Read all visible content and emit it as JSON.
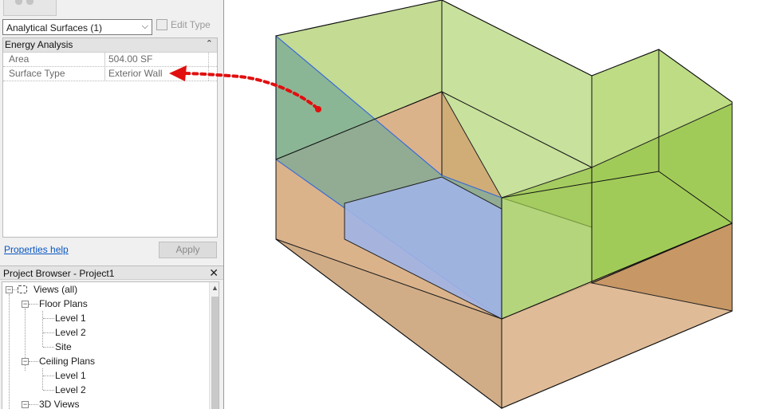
{
  "properties": {
    "type_selector": "Analytical Surfaces (1)",
    "edit_type_label": "Edit Type",
    "group": "Energy Analysis",
    "rows": [
      {
        "name": "Area",
        "value": "504.00 SF"
      },
      {
        "name": "Surface Type",
        "value": "Exterior Wall"
      }
    ],
    "help_link": "Properties help",
    "apply_label": "Apply"
  },
  "project_browser": {
    "title": "Project Browser - Project1",
    "tree": {
      "views_all": "Views (all)",
      "floor_plans": "Floor Plans",
      "floor_level1": "Level 1",
      "floor_level2": "Level 2",
      "site": "Site",
      "ceiling_plans": "Ceiling Plans",
      "ceiling_level1": "Level 1",
      "ceiling_level2": "Level 2",
      "views_3d": "3D Views"
    }
  },
  "colors": {
    "upper_volume": "#c8dd9c",
    "lower_volume": "#dcb794",
    "lower_side": "#c4935f",
    "selected_wall": "#86b0a0",
    "floor_blue": "#a7b6e6",
    "annotation_arrow": "#e10f0f"
  }
}
